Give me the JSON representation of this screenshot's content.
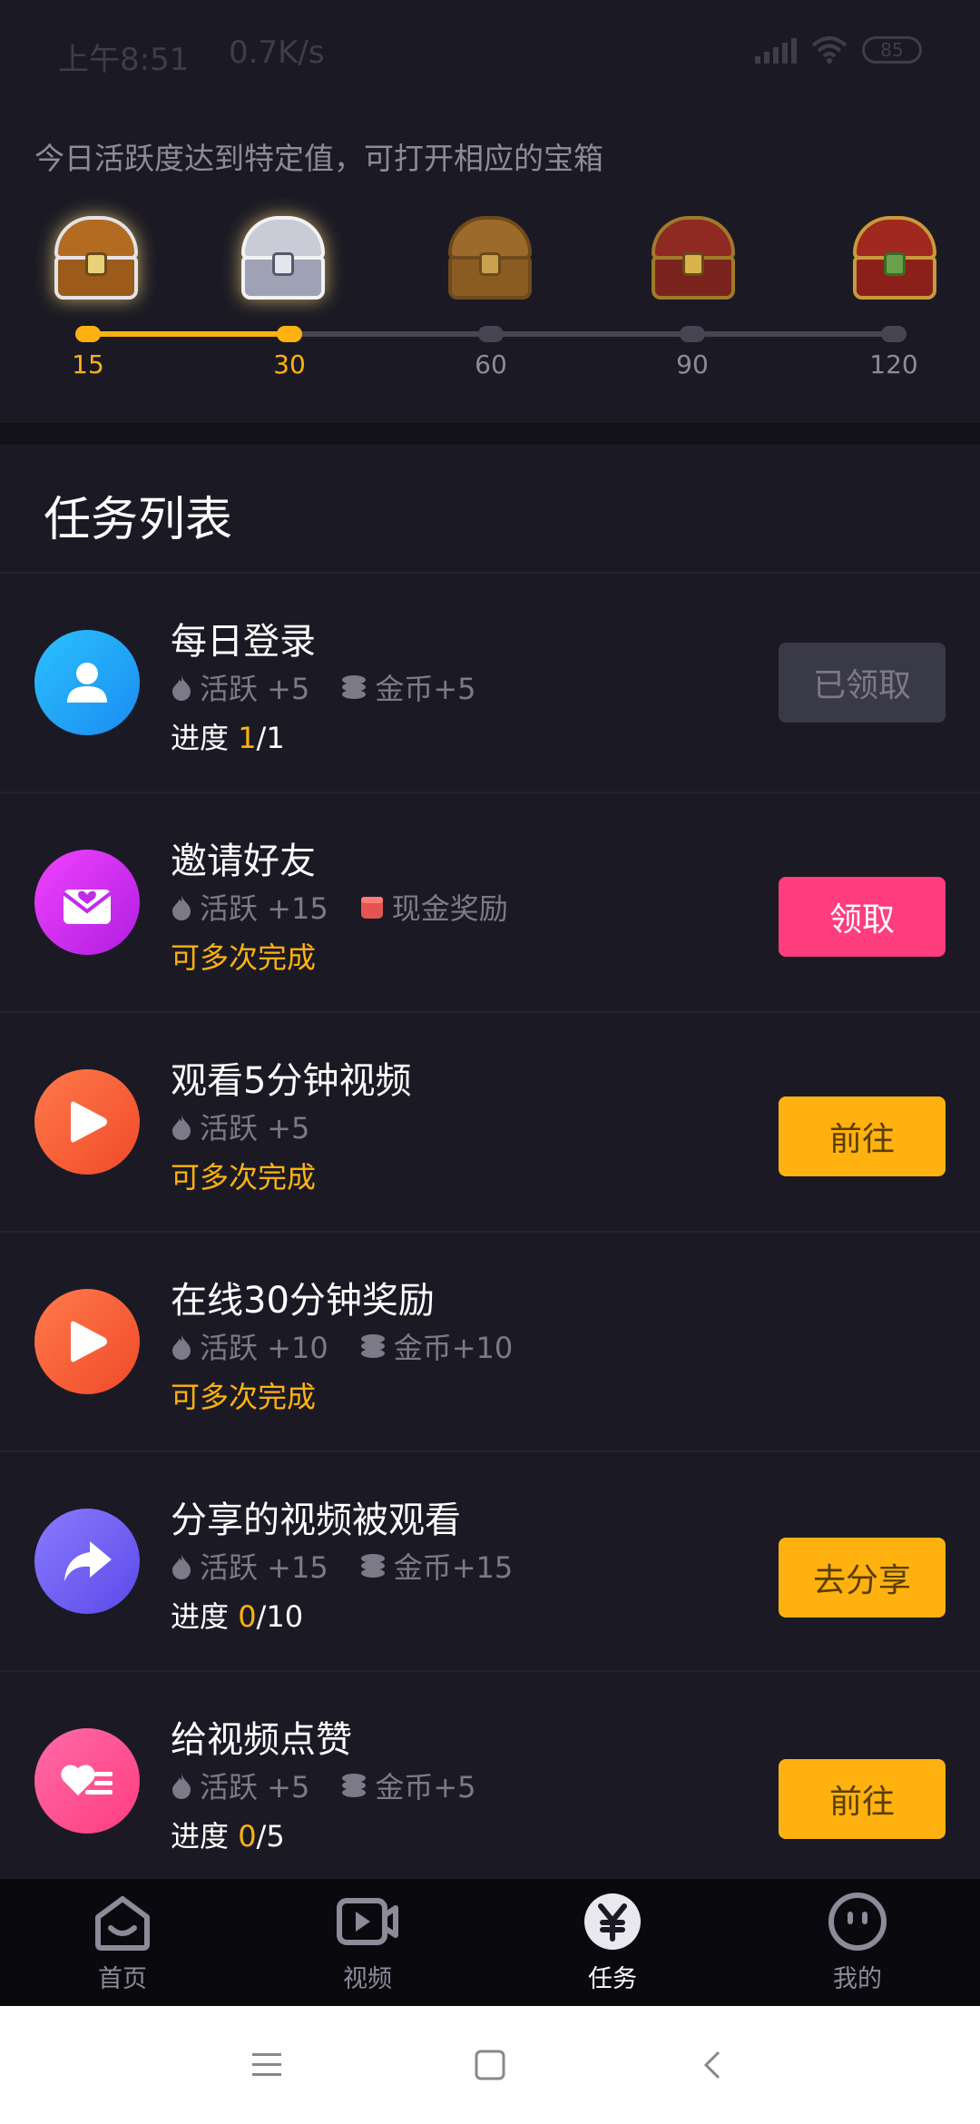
{
  "status": {
    "time": "上午8:51",
    "speed": "0.7K/s",
    "battery": "85"
  },
  "chests": {
    "hint": "今日活跃度达到特定值，可打开相应的宝箱",
    "milestones": [
      {
        "label": "15",
        "reached": true
      },
      {
        "label": "30",
        "reached": true
      },
      {
        "label": "60",
        "reached": false
      },
      {
        "label": "90",
        "reached": false
      },
      {
        "label": "120",
        "reached": false
      }
    ],
    "progress_fraction": 0.25
  },
  "task_list": {
    "title": "任务列表",
    "tasks": [
      {
        "name": "每日登录",
        "activity": "活跃 +5",
        "coin": "金币+5",
        "sub_prefix": "进度 ",
        "sub_num": "1",
        "sub_suffix": "/1",
        "button": "已领取"
      },
      {
        "name": "邀请好友",
        "activity": "活跃 +15",
        "cash": "现金奖励",
        "sub": "可多次完成",
        "button": "领取"
      },
      {
        "name": "观看5分钟视频",
        "activity": "活跃 +5",
        "sub": "可多次完成",
        "button": "前往"
      },
      {
        "name": "在线30分钟奖励",
        "activity": "活跃 +10",
        "coin": "金币+10",
        "sub": "可多次完成"
      },
      {
        "name": "分享的视频被观看",
        "activity": "活跃 +15",
        "coin": "金币+15",
        "sub_prefix": "进度 ",
        "sub_num": "0",
        "sub_suffix": "/10",
        "button": "去分享"
      },
      {
        "name": "给视频点赞",
        "activity": "活跃 +5",
        "coin": "金币+5",
        "sub_prefix": "进度 ",
        "sub_num": "0",
        "sub_suffix": "/5",
        "button": "前往"
      }
    ]
  },
  "nav": {
    "items": [
      {
        "label": "首页",
        "icon": "home-icon"
      },
      {
        "label": "视频",
        "icon": "video-icon"
      },
      {
        "label": "任务",
        "icon": "yuan-icon",
        "active": true
      },
      {
        "label": "我的",
        "icon": "profile-icon"
      }
    ]
  },
  "colors": {
    "accent": "#ffb20f",
    "pink": "#ff3d7f",
    "background": "#1b1a24"
  }
}
